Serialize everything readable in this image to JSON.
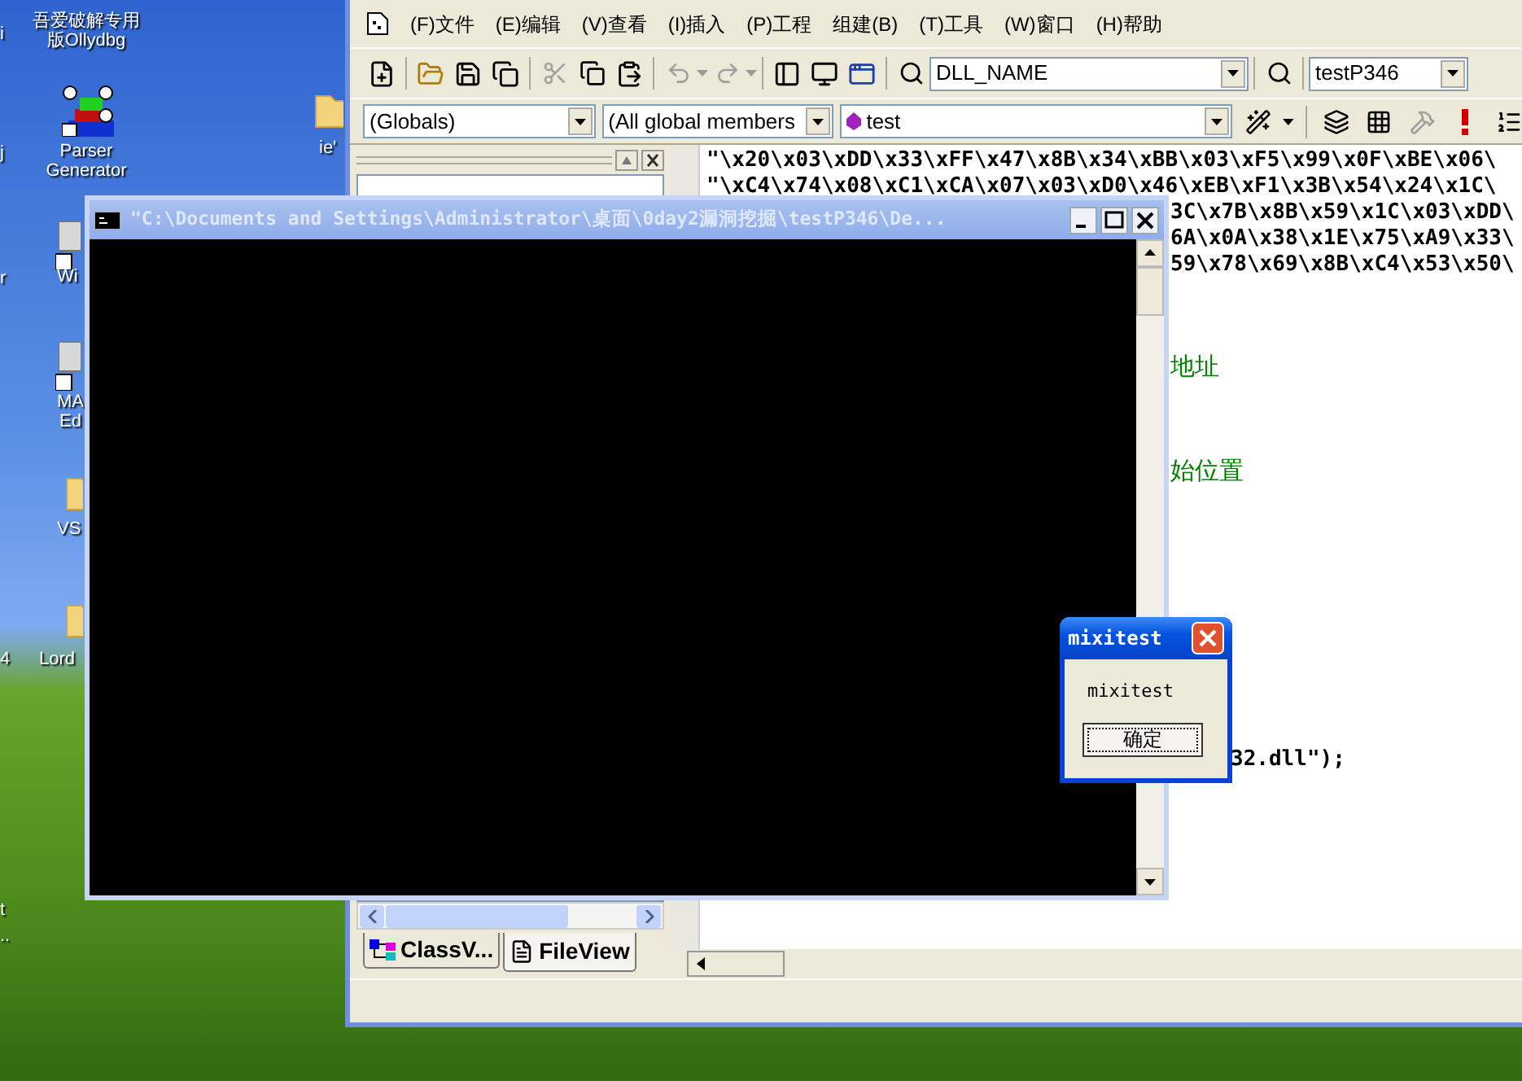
{
  "desktop_icons": [
    {
      "kind": "text_only",
      "label": [
        "吾爱破解专用",
        "版Ollydbg"
      ]
    },
    {
      "kind": "parser",
      "label": [
        "Parser",
        "Generator"
      ]
    },
    {
      "kind": "folder",
      "label": [
        "ie'"
      ]
    },
    {
      "kind": "app",
      "label": [
        "Wi"
      ]
    },
    {
      "kind": "app",
      "label": [
        "MA",
        "Ed"
      ]
    },
    {
      "kind": "folder",
      "label": [
        "VS"
      ]
    },
    {
      "kind": "folder",
      "label": [
        "Lord"
      ]
    }
  ],
  "edge_labels": [
    "i",
    "j",
    "r",
    "4",
    "t",
    ".."
  ],
  "ide": {
    "menu": [
      "(F)文件",
      "(E)编辑",
      "(V)查看",
      "(I)插入",
      "(P)工程",
      "组建(B)",
      "(T)工具",
      "(W)窗口",
      "(H)帮助"
    ],
    "toolbar_combos": [
      "DLL_NAME",
      "testP346"
    ],
    "wizard_combos": [
      "(Globals)",
      "(All global members",
      "test"
    ],
    "workspace_tabs": [
      {
        "label": "ClassV...",
        "selected": false
      },
      {
        "label": "FileView",
        "selected": true
      }
    ],
    "code_lines": [
      {
        "kind": "code",
        "text": "\"\\x20\\x03\\xDD\\x33\\xFF\\x47\\x8B\\x34\\xBB\\x03\\xF5\\x99\\x0F\\xBE\\x06\\"
      },
      {
        "kind": "code",
        "text": "\"\\xC4\\x74\\x08\\xC1\\xCA\\x07\\x03\\xD0\\x46\\xEB\\xF1\\x3B\\x54\\x24\\x1C\\"
      },
      {
        "kind": "code",
        "text": "3C\\x7B\\x8B\\x59\\x1C\\x03\\xDD\\"
      },
      {
        "kind": "code",
        "text": "6A\\x0A\\x38\\x1E\\x75\\xA9\\x33\\"
      },
      {
        "kind": "code",
        "text": "59\\x78\\x69\\x8B\\xC4\\x53\\x50\\"
      },
      {
        "kind": "comment",
        "text": "地址"
      },
      {
        "kind": "comment",
        "text": "始位置"
      },
      {
        "kind": "code",
        "text": "32.dll\");"
      }
    ]
  },
  "console": {
    "title": "\"C:\\Documents and Settings\\Administrator\\桌面\\0day2漏洞挖掘\\testP346\\De..."
  },
  "message_box": {
    "title": "mixitest",
    "text": "mixitest",
    "button": "确定"
  }
}
